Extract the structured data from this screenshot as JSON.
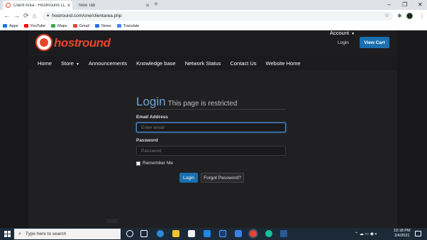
{
  "browser": {
    "tabs": [
      {
        "title": "Client Area - HostRound LLC",
        "active": true
      },
      {
        "title": "New Tab",
        "active": false
      }
    ],
    "url": "hostround.com/one/clientarea.php",
    "bookmarks": [
      {
        "label": "Apps",
        "icon": "apps-grid-icon",
        "color": "#1a73e8"
      },
      {
        "label": "YouTube",
        "icon": "youtube-icon",
        "color": "#ff0000"
      },
      {
        "label": "Maps",
        "icon": "maps-pin-icon",
        "color": "#34a853"
      },
      {
        "label": "Gmail",
        "icon": "gmail-icon",
        "color": "#ea4335"
      },
      {
        "label": "News",
        "icon": "news-icon",
        "color": "#1a73e8"
      },
      {
        "label": "Translate",
        "icon": "translate-icon",
        "color": "#4285f4"
      }
    ]
  },
  "site": {
    "logo_text": "hostround",
    "brand_color": "#e8452c",
    "accent": "#1a6fb0",
    "header_login": "Login",
    "view_cart": "View Cart",
    "nav": [
      {
        "label": "Home",
        "dropdown": false
      },
      {
        "label": "Store",
        "dropdown": true
      },
      {
        "label": "Announcements",
        "dropdown": false
      },
      {
        "label": "Knowledge base",
        "dropdown": false
      },
      {
        "label": "Network Status",
        "dropdown": false
      },
      {
        "label": "Contact Us",
        "dropdown": false
      },
      {
        "label": "Website Home",
        "dropdown": false
      }
    ],
    "account": "Account"
  },
  "form": {
    "title": "Login",
    "subtitle": "This page is restricted",
    "email_label": "Email Address",
    "email_placeholder": "Enter email",
    "password_label": "Password",
    "password_placeholder": "Password",
    "remember_label": "Remember Me",
    "login_button": "Login",
    "forgot_button": "Forgot Password?"
  },
  "taskbar": {
    "search_placeholder": "Type here to search",
    "time": "10:18 PM",
    "date": "2/4/2021"
  }
}
